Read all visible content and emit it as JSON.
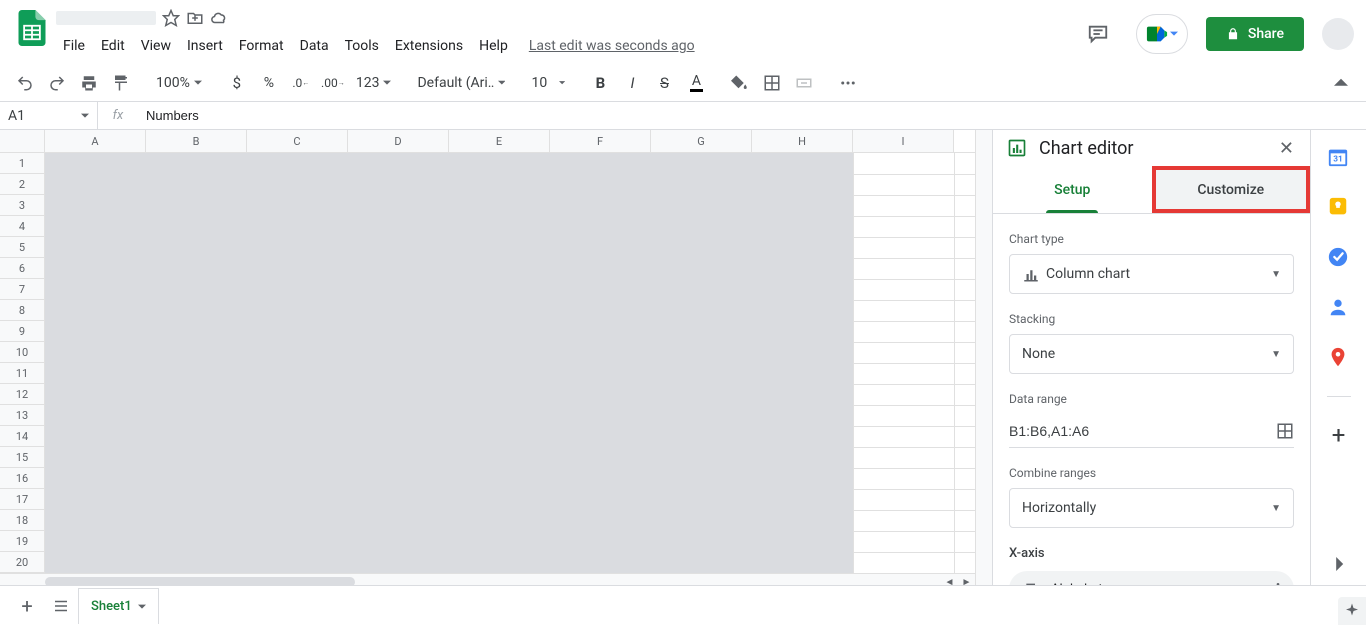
{
  "doc": {
    "title_placeholder": ""
  },
  "menus": [
    "File",
    "Edit",
    "View",
    "Insert",
    "Format",
    "Data",
    "Tools",
    "Extensions",
    "Help"
  ],
  "last_edit": "Last edit was seconds ago",
  "share_label": "Share",
  "toolbar": {
    "zoom": "100%",
    "font": "Default (Ari…",
    "font_size": "10",
    "number_format": "123"
  },
  "name_box": "A1",
  "fx_value": "Numbers",
  "columns": [
    "A",
    "B",
    "C",
    "D",
    "E",
    "F",
    "G",
    "H",
    "I"
  ],
  "rows": [
    "1",
    "2",
    "3",
    "4",
    "5",
    "6",
    "7",
    "8",
    "9",
    "10",
    "11",
    "12",
    "13",
    "14",
    "15",
    "16",
    "17",
    "18",
    "19",
    "20"
  ],
  "chart_editor": {
    "title": "Chart editor",
    "tab_setup": "Setup",
    "tab_customize": "Customize",
    "chart_type_label": "Chart type",
    "chart_type_value": "Column chart",
    "stacking_label": "Stacking",
    "stacking_value": "None",
    "data_range_label": "Data range",
    "data_range_value": "B1:B6,A1:A6",
    "combine_label": "Combine ranges",
    "combine_value": "Horizontally",
    "xaxis_label": "X-axis",
    "xaxis_value": "Alphabets"
  },
  "sheet": {
    "name": "Sheet1"
  }
}
